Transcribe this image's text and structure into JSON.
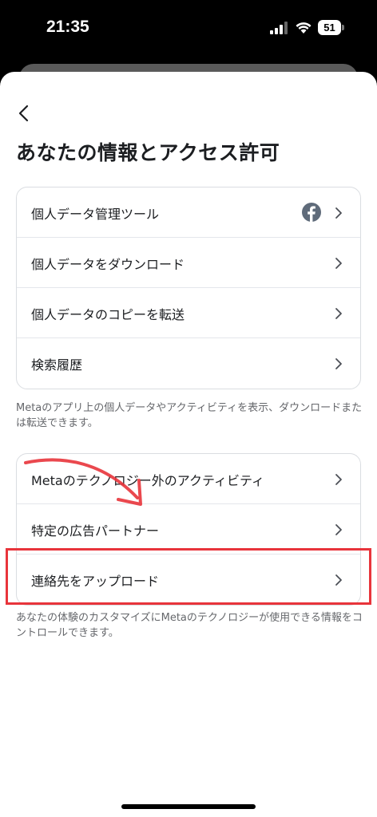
{
  "status_bar": {
    "time": "21:35",
    "battery": "51"
  },
  "page": {
    "title": "あなたの情報とアクセス許可"
  },
  "section1": {
    "items": [
      {
        "label": "個人データ管理ツール"
      },
      {
        "label": "個人データをダウンロード"
      },
      {
        "label": "個人データのコピーを転送"
      },
      {
        "label": "検索履歴"
      }
    ],
    "caption": "Metaのアプリ上の個人データやアクティビティを表示、ダウンロードまたは転送できます。"
  },
  "section2": {
    "items": [
      {
        "label": "Metaのテクノロジー外のアクティビティ"
      },
      {
        "label": "特定の広告パートナー"
      },
      {
        "label": "連絡先をアップロード"
      }
    ],
    "caption": "あなたの体験のカスタマイズにMetaのテクノロジーが使用できる情報をコントロールできます。"
  },
  "colors": {
    "annotation_red": "#e8343b",
    "text_primary": "#1c1e21",
    "text_secondary": "#65676b"
  },
  "icons": [
    "back-icon",
    "facebook-icon",
    "chevron-right-icon"
  ]
}
